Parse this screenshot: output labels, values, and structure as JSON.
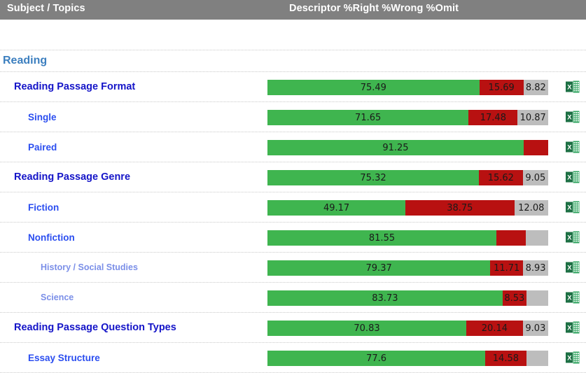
{
  "header": {
    "subject_label": "Subject / Topics",
    "metrics_label": "Descriptor %Right %Wrong %Omit"
  },
  "colors": {
    "header_bg": "#808080",
    "right": "#3fb54f",
    "wrong": "#b81111",
    "omit": "#bdbdbd",
    "section_text": "#3c7fbf",
    "level1_text": "#1414c8",
    "level2_text": "#2b4ef0",
    "level3_text": "#7b8fe8"
  },
  "icons": {
    "export_excel": "excel-export-icon"
  },
  "chart_data": {
    "type": "bar",
    "title": "",
    "subtitle": "",
    "xlabel": "",
    "ylabel": "",
    "xlim": [
      0,
      100
    ],
    "grid": false,
    "legend_position": "header",
    "orientation": "horizontal",
    "stacked": true,
    "series": [
      {
        "name": "%Right",
        "color": "#3fb54f"
      },
      {
        "name": "%Wrong",
        "color": "#b81111"
      },
      {
        "name": "%Omit",
        "color": "#bdbdbd"
      }
    ],
    "categories": [
      "Reading Passage Format",
      "Single",
      "Paired",
      "Reading Passage Genre",
      "Fiction",
      "Nonfiction",
      "History / Social Studies",
      "Science",
      "Reading Passage Question Types",
      "Essay Structure"
    ],
    "values": {
      "%Right": [
        75.49,
        71.65,
        91.25,
        75.32,
        49.17,
        81.55,
        79.37,
        83.73,
        70.83,
        77.6
      ],
      "%Wrong": [
        15.69,
        17.48,
        8.75,
        15.62,
        38.75,
        10.45,
        11.71,
        8.53,
        20.14,
        14.58
      ],
      "%Omit": [
        8.82,
        10.87,
        0.0,
        9.05,
        12.08,
        8.0,
        8.93,
        7.74,
        9.03,
        7.82
      ]
    }
  },
  "rows": [
    {
      "kind": "spacer",
      "level": 0,
      "label": "",
      "bar": false
    },
    {
      "kind": "section",
      "level": 0,
      "label": "Reading",
      "bar": false
    },
    {
      "kind": "topic",
      "level": 1,
      "label": "Reading Passage Format",
      "bar": true,
      "right": {
        "value": 75.49,
        "text": "75.49"
      },
      "wrong": {
        "value": 15.69,
        "text": "15.69"
      },
      "omit": {
        "value": 8.82,
        "text": "8.82"
      },
      "export": "Export to Excel"
    },
    {
      "kind": "topic",
      "level": 2,
      "label": "Single",
      "bar": true,
      "right": {
        "value": 71.65,
        "text": "71.65"
      },
      "wrong": {
        "value": 17.48,
        "text": "17.48"
      },
      "omit": {
        "value": 10.87,
        "text": "10.87"
      },
      "export": "Export to Excel"
    },
    {
      "kind": "topic",
      "level": 2,
      "label": "Paired",
      "bar": true,
      "right": {
        "value": 91.25,
        "text": "91.25"
      },
      "wrong": {
        "value": 8.75,
        "text": ""
      },
      "omit": {
        "value": 0,
        "text": ""
      },
      "export": "Export to Excel"
    },
    {
      "kind": "topic",
      "level": 1,
      "label": "Reading Passage Genre",
      "bar": true,
      "right": {
        "value": 75.32,
        "text": "75.32"
      },
      "wrong": {
        "value": 15.62,
        "text": "15.62"
      },
      "omit": {
        "value": 9.05,
        "text": "9.05"
      },
      "export": "Export to Excel"
    },
    {
      "kind": "topic",
      "level": 2,
      "label": "Fiction",
      "bar": true,
      "right": {
        "value": 49.17,
        "text": "49.17"
      },
      "wrong": {
        "value": 38.75,
        "text": "38.75"
      },
      "omit": {
        "value": 12.08,
        "text": "12.08"
      },
      "export": "Export to Excel"
    },
    {
      "kind": "topic",
      "level": 2,
      "label": "Nonfiction",
      "bar": true,
      "right": {
        "value": 81.55,
        "text": "81.55"
      },
      "wrong": {
        "value": 10.45,
        "text": ""
      },
      "omit": {
        "value": 8.0,
        "text": ""
      },
      "export": "Export to Excel"
    },
    {
      "kind": "topic",
      "level": 3,
      "label": "History / Social Studies",
      "bar": true,
      "right": {
        "value": 79.37,
        "text": "79.37"
      },
      "wrong": {
        "value": 11.71,
        "text": "11.71"
      },
      "omit": {
        "value": 8.93,
        "text": "8.93"
      },
      "export": "Export to Excel"
    },
    {
      "kind": "topic",
      "level": 3,
      "label": "Science",
      "bar": true,
      "right": {
        "value": 83.73,
        "text": "83.73"
      },
      "wrong": {
        "value": 8.53,
        "text": "8.53"
      },
      "omit": {
        "value": 7.74,
        "text": ""
      },
      "export": "Export to Excel"
    },
    {
      "kind": "topic",
      "level": 1,
      "label": "Reading Passage Question Types",
      "bar": true,
      "right": {
        "value": 70.83,
        "text": "70.83"
      },
      "wrong": {
        "value": 20.14,
        "text": "20.14"
      },
      "omit": {
        "value": 9.03,
        "text": "9.03"
      },
      "export": "Export to Excel"
    },
    {
      "kind": "topic",
      "level": 2,
      "label": "Essay Structure",
      "bar": true,
      "right": {
        "value": 77.6,
        "text": "77.6"
      },
      "wrong": {
        "value": 14.58,
        "text": "14.58"
      },
      "omit": {
        "value": 7.82,
        "text": ""
      },
      "export": "Export to Excel"
    }
  ]
}
